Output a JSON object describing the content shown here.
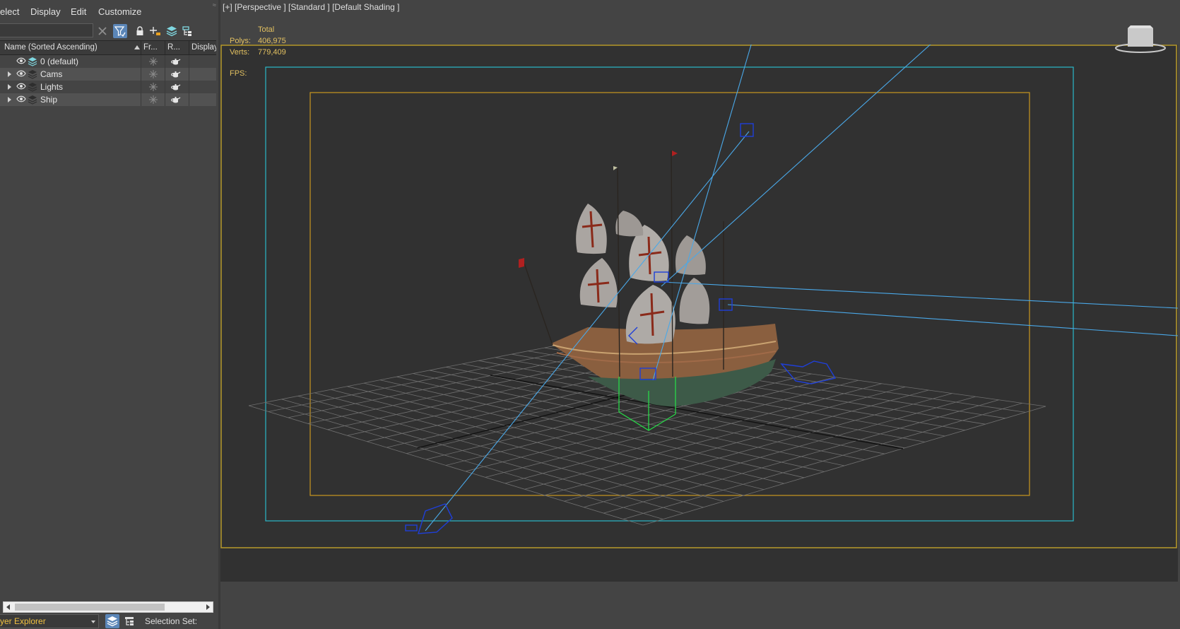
{
  "menu": {
    "select": "elect",
    "display": "Display",
    "edit": "Edit",
    "customize": "Customize"
  },
  "columns": {
    "name": "Name (Sorted Ascending)",
    "frozen": "Fr...",
    "render": "R...",
    "display": "Display"
  },
  "layers": [
    {
      "label": "0 (default)",
      "expandable": false,
      "alt": false
    },
    {
      "label": "Cams",
      "expandable": true,
      "alt": true
    },
    {
      "label": "Lights",
      "expandable": true,
      "alt": false
    },
    {
      "label": "Ship",
      "expandable": true,
      "alt": true
    }
  ],
  "footer": {
    "explorer_type": "yer Explorer",
    "selection_set": "Selection Set:"
  },
  "viewport": {
    "label": "[+] [Perspective ] [Standard ] [Default Shading ]",
    "stats_header": "Total",
    "polys_label": "Polys:",
    "polys_value": "406,975",
    "verts_label": "Verts:",
    "verts_value": "779,409",
    "fps_label": "FPS:"
  },
  "colors": {
    "viewport_bg": "#313131",
    "safe_frame_outer": "#b89a2a",
    "safe_frame_action": "#2ab8c8",
    "safe_frame_title": "#c8961e",
    "camera_lines": "#4aa8e8",
    "camera_icons": "#1f3fd8",
    "selected_box": "#28d848"
  }
}
